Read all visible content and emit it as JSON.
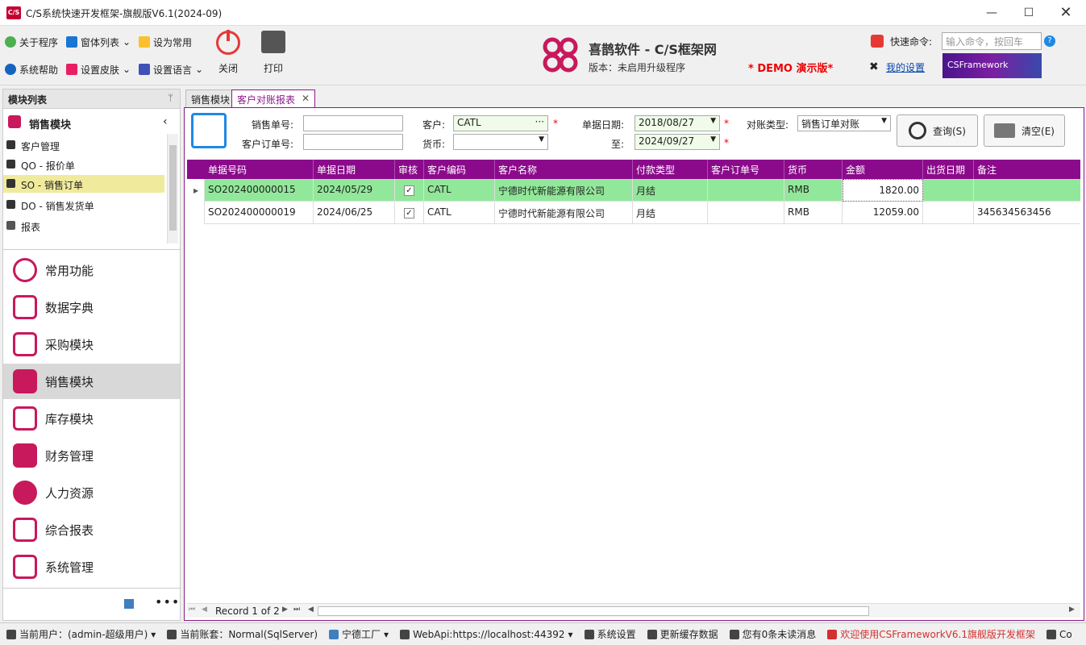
{
  "window": {
    "title": "C/S系统快速开发框架-旗舰版V6.1(2024-09)",
    "app_icon": "C/S",
    "min_icon": "minimize-icon",
    "max_icon": "maximize-icon",
    "close_icon": "close-icon"
  },
  "ribbon": {
    "about": "关于程序",
    "windows": "窗体列表",
    "set_common": "设为常用",
    "help": "系统帮助",
    "skin": "设置皮肤",
    "language": "设置语言",
    "close": "关闭",
    "print": "打印"
  },
  "brand": {
    "title": "喜鹊软件 - C/S框架网",
    "version": "版本：未启用升级程序",
    "demo": "* DEMO 演示版*",
    "cmd_label": "快速命令:",
    "cmd_placeholder": "输入命令，按回车",
    "my_settings": "我的设置",
    "banner": "CSFramework"
  },
  "left_panel": {
    "header": "模块列表",
    "tree_root": "销售模块",
    "tree_items": [
      "客户管理",
      "QO - 报价单",
      "SO - 销售订单",
      "DO - 销售发货单",
      "报表"
    ],
    "modules": [
      "常用功能",
      "数据字典",
      "采购模块",
      "销售模块",
      "库存模块",
      "财务管理",
      "人力资源",
      "综合报表",
      "系统管理"
    ]
  },
  "tabs": [
    "销售模块",
    "客户对账报表"
  ],
  "filters": {
    "sales_no_label": "销售单号:",
    "cust_order_label": "客户订单号:",
    "customer_label": "客户:",
    "customer_value": "CATL",
    "currency_label": "货币:",
    "date_label": "单据日期:",
    "date_from": "2018/08/27",
    "to_label": "至:",
    "date_to": "2024/09/27",
    "recon_type_label": "对账类型:",
    "recon_type_value": "销售订单对账",
    "query_button": "查询(S)",
    "clear_button": "清空(E)",
    "required_mark": "*"
  },
  "grid": {
    "columns": [
      "单据号码",
      "单据日期",
      "审核",
      "客户编码",
      "客户名称",
      "付款类型",
      "客户订单号",
      "货币",
      "金额",
      "出货日期",
      "备注"
    ],
    "rows": [
      {
        "no": "SO202400000015",
        "date": "2024/05/29",
        "check": "✓",
        "cust_code": "CATL",
        "cust_name": "宁德时代新能源有限公司",
        "pay": "月结",
        "cust_order": "",
        "currency": "RMB",
        "amount": "1820.00",
        "ship_date": "",
        "remark": ""
      },
      {
        "no": "SO202400000019",
        "date": "2024/06/25",
        "check": "✓",
        "cust_code": "CATL",
        "cust_name": "宁德时代新能源有限公司",
        "pay": "月结",
        "cust_order": "",
        "currency": "RMB",
        "amount": "12059.00",
        "ship_date": "",
        "remark": "345634563456"
      }
    ],
    "record_text": "Record 1 of 2"
  },
  "status": {
    "user": "当前用户：(admin-超级用户)",
    "account": "当前账套：Normal(SqlServer)",
    "factory": "宁德工厂",
    "webapi": "WebApi:https://localhost:44392",
    "sys_settings": "系统设置",
    "update_cache": "更新缓存数据",
    "messages": "您有0条未读消息",
    "welcome": "欢迎使用CSFrameworkV6.1旗舰版开发框架",
    "copyright": "Co"
  },
  "colors": {
    "accent": "#8b0a8b",
    "highlight_row": "#92e89a",
    "brand_pink": "#c8195c",
    "demo_red": "#e00000"
  }
}
